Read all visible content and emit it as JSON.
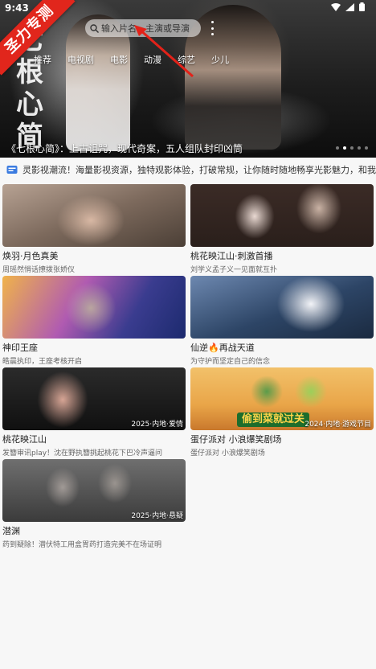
{
  "status": {
    "time": "9:43"
  },
  "ribbon": "圣力专测",
  "hero": {
    "bg_title": "七根心简",
    "search_placeholder": "输入片名、主演或导演",
    "tabs": [
      "推荐",
      "电视剧",
      "电影",
      "动漫",
      "综艺",
      "少儿"
    ],
    "caption": "《七根心简》：上古诅咒，现代奇案，五人组队封印凶筒",
    "dots": 5,
    "active_dot": 1
  },
  "notice": {
    "text": "灵影视潮流！海量影视资源，独特观影体验，打破常规，让你随时随地畅享光影魅力，和我"
  },
  "cards": [
    {
      "title": "焕羽·月色真美",
      "subtitle": "周瑶然悄话撩拨张娇仪",
      "badge": ""
    },
    {
      "title": "桃花映江山·刺激首播",
      "subtitle": "刘学义孟子义一见面就互扑",
      "badge": ""
    },
    {
      "title": "神印王座",
      "subtitle": "皓晨执印，王座考核开启",
      "badge": ""
    },
    {
      "title": "仙逆🔥再战天道",
      "subtitle": "为守护而坚定自己的信念",
      "badge": ""
    },
    {
      "title": "桃花映江山",
      "subtitle": "发簪审讯play！沈在野执簪挑起桃花下巴冷声逼问",
      "badge": "2025·内地·爱情"
    },
    {
      "title": "蛋仔派对 小浪爆笑剧场",
      "subtitle": "蛋仔派对 小浪爆笑剧场",
      "badge": "2024·内地·游戏节目",
      "banner": "偷到菜就过关"
    },
    {
      "title": "潜渊",
      "subtitle": "药到疑除！潜伏特工用盒胃药打造完美不在场证明",
      "badge": "2025·内地·悬疑"
    }
  ]
}
